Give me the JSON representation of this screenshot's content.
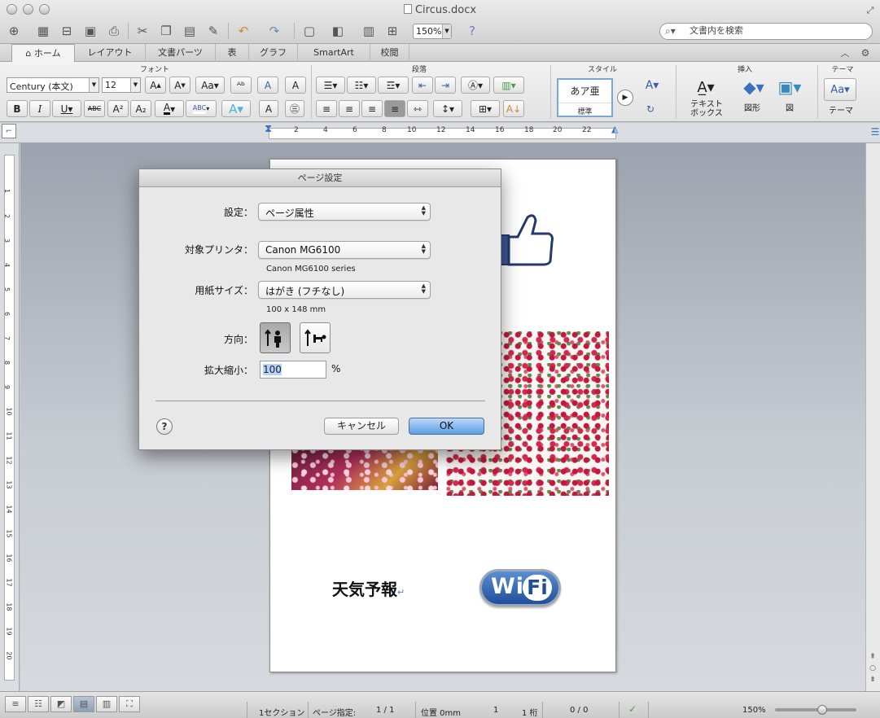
{
  "window": {
    "title": "Circus.docx"
  },
  "toolbar": {
    "zoom": "150%",
    "search_placeholder": "文書内を検索"
  },
  "ribbon_tabs": [
    {
      "label": "ホーム",
      "active": true
    },
    {
      "label": "レイアウト"
    },
    {
      "label": "文書パーツ"
    },
    {
      "label": "表"
    },
    {
      "label": "グラフ"
    },
    {
      "label": "SmartArt"
    },
    {
      "label": "校閲"
    }
  ],
  "ribbon": {
    "groups": {
      "font": "フォント",
      "paragraph": "段落",
      "style": "スタイル",
      "insert": "挿入",
      "theme": "テーマ"
    },
    "font_name": "Century (本文)",
    "font_size": "12",
    "style_preview": "あア亜",
    "style_name": "標準",
    "insert_textbox": "テキスト\nボックス",
    "insert_textbox_l1": "テキスト",
    "insert_textbox_l2": "ボックス",
    "insert_shape": "図形",
    "insert_picture": "図",
    "theme_label": "テーマ",
    "theme_preview": "Aa"
  },
  "ruler": {
    "ticks": [
      "2",
      "4",
      "6",
      "8",
      "10",
      "12",
      "14",
      "16",
      "18",
      "20",
      "22"
    ]
  },
  "vruler": {
    "ticks": [
      "1",
      "2",
      "3",
      "4",
      "5",
      "6",
      "7",
      "8",
      "9",
      "10",
      "11",
      "12",
      "13",
      "14",
      "15",
      "16",
      "17",
      "18",
      "19",
      "20"
    ]
  },
  "document": {
    "weather_text": "天気予報",
    "wifi_text": "Wi",
    "wifi_fi": "Fi"
  },
  "dialog": {
    "title": "ページ設定",
    "settings_label": "設定：",
    "settings_value": "ページ属性",
    "printer_label": "対象プリンタ：",
    "printer_value": "Canon MG6100",
    "printer_sub": "Canon MG6100 series",
    "paper_label": "用紙サイズ：",
    "paper_value": "はがき (フチなし)",
    "paper_sub": "100 x 148 mm",
    "orientation_label": "方向：",
    "scale_label": "拡大縮小：",
    "scale_value": "100",
    "scale_unit": "%",
    "help": "?",
    "cancel_label": "キャンセル",
    "ok_label": "OK"
  },
  "statusbar": {
    "section": "1セクション",
    "page_label": "ページ指定:",
    "page_value": "1 / 1",
    "position": "位置 0mm",
    "line": "1",
    "col": "1 桁",
    "words": "0 / 0",
    "zoom": "150%"
  }
}
